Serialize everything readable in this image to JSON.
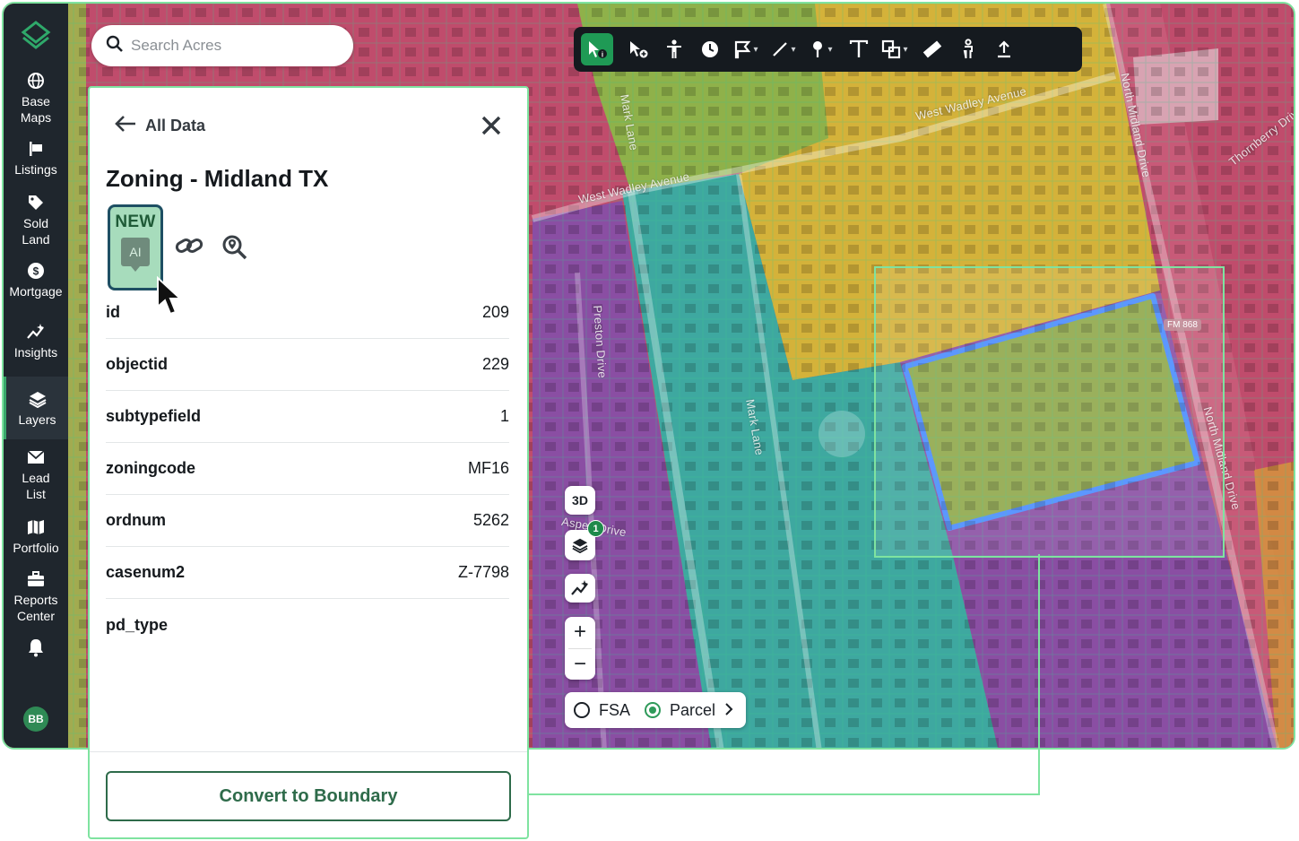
{
  "sidebar": {
    "items": [
      {
        "label": "Base\nMaps",
        "icon": "globe-icon"
      },
      {
        "label": "Listings",
        "icon": "sign-icon"
      },
      {
        "label": "Sold\nLand",
        "icon": "tag-icon"
      },
      {
        "label": "Mortgage",
        "icon": "dollar-icon"
      },
      {
        "label": "Insights",
        "icon": "sparkle-chart-icon"
      },
      {
        "label": "Layers",
        "icon": "layers-icon"
      },
      {
        "label": "Lead\nList",
        "icon": "mail-icon"
      },
      {
        "label": "Portfolio",
        "icon": "map-book-icon"
      },
      {
        "label": "Reports\nCenter",
        "icon": "briefcase-icon"
      }
    ],
    "active": "Layers",
    "avatar_initials": "BB"
  },
  "search": {
    "placeholder": "Search Acres"
  },
  "toolbar": {
    "tools": [
      "select-info",
      "select-add",
      "person",
      "clock",
      "flag",
      "line",
      "pin",
      "text",
      "shapes",
      "ruler",
      "pedestrian",
      "upload"
    ],
    "active_tool": "select-info"
  },
  "map": {
    "streets": {
      "west_wadley_1": "West Wadley Avenue",
      "west_wadley_2": "West Wadley Avenue",
      "mark_lane_1": "Mark Lane",
      "mark_lane_2": "Mark Lane",
      "preston": "Preston Drive",
      "north_midland_1": "North Midland Drive",
      "north_midland_2": "North Midland Drive",
      "thornberry": "Thornberry Drive",
      "aspen": "Aspen Drive"
    },
    "fm_badge": "FM 868",
    "colors": {
      "residential": "#c04c6c",
      "commercial": "#d4b23a",
      "multifamily_green": "#8fb14a",
      "teal": "#3ea8a0",
      "purple": "#8a4ea3",
      "selected_outline": "#4a8cff"
    }
  },
  "controls": {
    "three_d": "3D",
    "layers_count": "1",
    "zoom_in": "+",
    "zoom_out": "−",
    "mode_fsa": "FSA",
    "mode_parcel": "Parcel",
    "selected_mode": "Parcel"
  },
  "panel": {
    "back_label": "All Data",
    "title": "Zoning - Midland TX",
    "ai_badge_new": "NEW",
    "ai_badge_text": "AI",
    "rows": [
      {
        "key": "id",
        "value": "209"
      },
      {
        "key": "objectid",
        "value": "229"
      },
      {
        "key": "subtypefield",
        "value": "1"
      },
      {
        "key": "zoningcode",
        "value": "MF16"
      },
      {
        "key": "ordnum",
        "value": "5262"
      },
      {
        "key": "casenum2",
        "value": "Z-7798"
      },
      {
        "key": "pd_type",
        "value": ""
      }
    ],
    "convert_button": "Convert to Boundary"
  }
}
